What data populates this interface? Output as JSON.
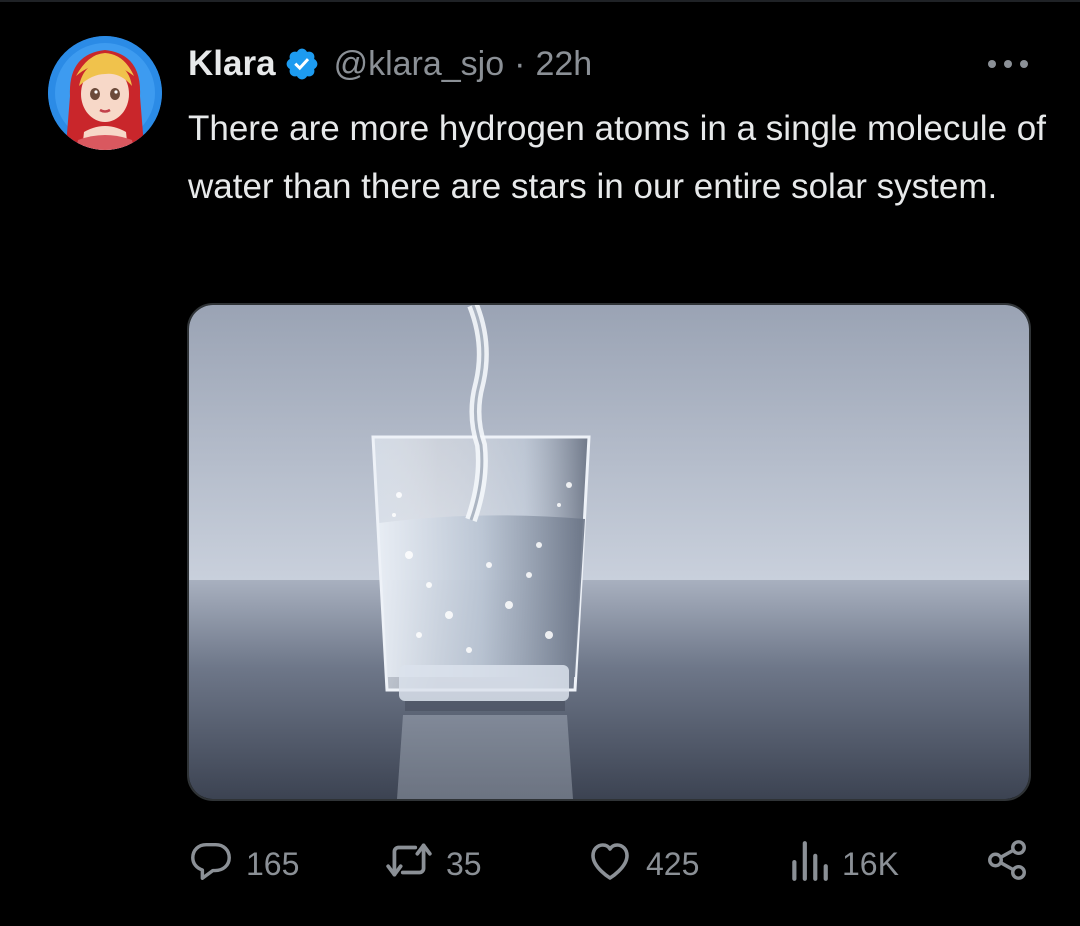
{
  "tweet": {
    "author_name": "Klara",
    "handle": "@klara_sjo",
    "separator": "·",
    "time": "22h",
    "text": "There are more hydrogen atoms in a single molecule of water than there are stars in our entire solar system.",
    "media": {
      "alt_icon": "glass-of-water-photo"
    }
  },
  "actions": {
    "replies": "165",
    "reposts": "35",
    "likes": "425",
    "views": "16K"
  },
  "icons": {
    "verified": "verified-badge-icon",
    "more": "more-icon",
    "reply": "reply-icon",
    "repost": "repost-icon",
    "like": "heart-icon",
    "views": "views-icon",
    "share": "share-icon"
  },
  "colors": {
    "background": "#000000",
    "text": "#e7e9ea",
    "secondary": "#8b9096",
    "verified": "#1d9bf0"
  }
}
